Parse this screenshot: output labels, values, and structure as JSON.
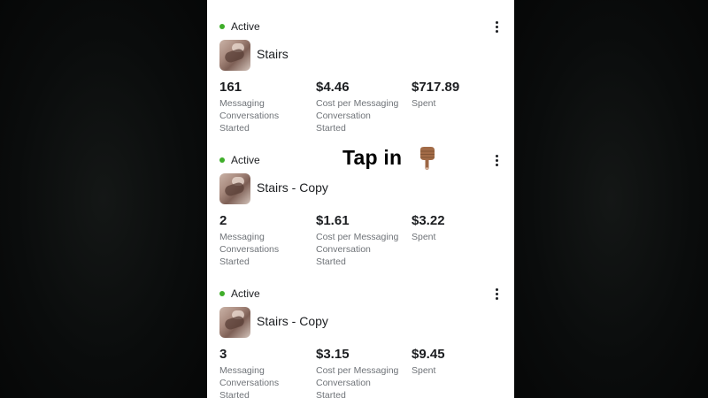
{
  "cards": [
    {
      "status": "Active",
      "name": "Stairs",
      "metrics": [
        {
          "value": "161",
          "label": "Messaging\nConversations\nStarted"
        },
        {
          "value": "$4.46",
          "label": "Cost per Messaging\nConversation\nStarted"
        },
        {
          "value": "$717.89",
          "label": "Spent"
        }
      ]
    },
    {
      "status": "Active",
      "name": "Stairs - Copy",
      "metrics": [
        {
          "value": "2",
          "label": "Messaging\nConversations\nStarted"
        },
        {
          "value": "$1.61",
          "label": "Cost per Messaging\nConversation\nStarted"
        },
        {
          "value": "$3.22",
          "label": "Spent"
        }
      ]
    },
    {
      "status": "Active",
      "name": "Stairs - Copy",
      "metrics": [
        {
          "value": "3",
          "label": "Messaging\nConversations\nStarted"
        },
        {
          "value": "$3.15",
          "label": "Cost per Messaging\nConversation\nStarted"
        },
        {
          "value": "$9.45",
          "label": "Spent"
        }
      ]
    }
  ],
  "overlay": {
    "text": "Tap in",
    "emoji_icon": "pointing-down-hand-icon"
  },
  "colors": {
    "status_active": "#3fae2a",
    "background": "#080a0a",
    "card_bg": "#ffffff",
    "primary_text": "#1c1e21",
    "secondary_text": "#6f7378"
  }
}
